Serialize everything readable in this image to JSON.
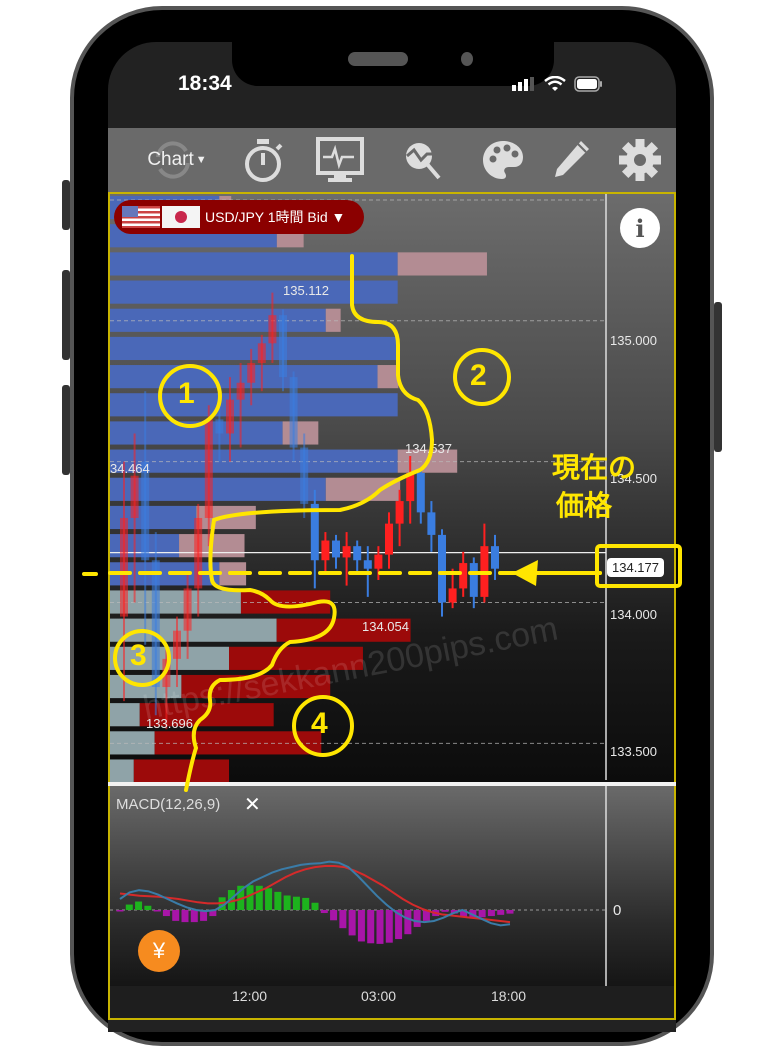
{
  "status_bar": {
    "time": "18:34"
  },
  "toolbar": {
    "chart_label": "Chart",
    "items": [
      {
        "name": "chart-menu",
        "icon": "refresh-icon"
      },
      {
        "name": "timer",
        "icon": "stopwatch-icon"
      },
      {
        "name": "monitor",
        "icon": "monitor-icon"
      },
      {
        "name": "indicator-search",
        "icon": "chart-search-icon"
      },
      {
        "name": "palette",
        "icon": "palette-icon"
      },
      {
        "name": "draw",
        "icon": "pencil-icon"
      },
      {
        "name": "settings",
        "icon": "gear-icon"
      }
    ]
  },
  "instrument": {
    "label": "USD/JPY 1時間 Bid ▼",
    "flags": [
      "US",
      "JP"
    ]
  },
  "price_axis": {
    "labels": [
      "135.000",
      "134.500",
      "134.000",
      "133.500"
    ],
    "current_price": "134.177"
  },
  "order_book_labels": {
    "high_marker": "135.112",
    "mid_marker_1": "134.537",
    "left_marker": "34.464",
    "low_marker_1": "134.054",
    "low_marker_2": "133.696"
  },
  "macd": {
    "title": "MACD(12,26,9)",
    "close_label": "✕",
    "zero_label": "0"
  },
  "time_axis": {
    "labels": [
      "12:00",
      "03:00",
      "18:00"
    ]
  },
  "annotations": {
    "circle_1": "1",
    "circle_2": "2",
    "circle_3": "3",
    "circle_4": "4",
    "current_price_note_line1": "現在の",
    "current_price_note_line2": "価格"
  },
  "watermark": "https://sekkann200pips.com",
  "colors": {
    "buy_bar": "#4a68b8",
    "sell_bar_light": "#b38c93",
    "buy_bar_lower": "#8fa3a8",
    "sell_bar_dark": "#9c0a0a",
    "annotation": "#ffe600",
    "macd_line": "#3a7ca8",
    "signal_line": "#d62a2a",
    "hist_pos": "#1db31d",
    "hist_neg": "#a815a8"
  },
  "chart_data": {
    "type": "candlestick-with-orderbook",
    "symbol": "USD/JPY",
    "timeframe": "1時間",
    "price_type": "Bid",
    "ylim": [
      133.37,
      135.45
    ],
    "yticks": [
      135.0,
      134.5,
      134.0,
      133.5
    ],
    "current_price": 134.177,
    "orderbook_rows": [
      {
        "price": 135.4,
        "buy": 0.38,
        "sell": 0.04
      },
      {
        "price": 135.3,
        "buy": 0.58,
        "sell": 0.09
      },
      {
        "price": 135.2,
        "buy": 1.0,
        "sell": 0.3
      },
      {
        "price": 135.1,
        "buy": 1.0,
        "sell": 0.0
      },
      {
        "price": 135.0,
        "buy": 0.75,
        "sell": 0.05
      },
      {
        "price": 134.9,
        "buy": 1.0,
        "sell": 0.0
      },
      {
        "price": 134.8,
        "buy": 0.93,
        "sell": 0.07
      },
      {
        "price": 134.7,
        "buy": 1.0,
        "sell": 0.0
      },
      {
        "price": 134.6,
        "buy": 0.6,
        "sell": 0.12
      },
      {
        "price": 134.5,
        "buy": 1.0,
        "sell": 0.2
      },
      {
        "price": 134.4,
        "buy": 0.75,
        "sell": 0.25
      },
      {
        "price": 134.3,
        "buy": 0.3,
        "sell": 0.2
      },
      {
        "price": 134.2,
        "buy": 0.24,
        "sell": 0.22
      },
      {
        "price": 134.1,
        "buy": 0.38,
        "sell": 0.09
      },
      {
        "price": 134.0,
        "lower_buy": 0.44,
        "lower_sell": 0.3
      },
      {
        "price": 133.9,
        "lower_buy": 0.56,
        "lower_sell": 0.45
      },
      {
        "price": 133.8,
        "lower_buy": 0.4,
        "lower_sell": 0.45
      },
      {
        "price": 133.7,
        "lower_buy": 0.24,
        "lower_sell": 0.5
      },
      {
        "price": 133.6,
        "lower_buy": 0.1,
        "lower_sell": 0.45
      },
      {
        "price": 133.5,
        "lower_buy": 0.15,
        "lower_sell": 0.56
      },
      {
        "price": 133.4,
        "lower_buy": 0.08,
        "lower_sell": 0.32
      }
    ],
    "candles": [
      {
        "o": 133.95,
        "h": 134.5,
        "l": 133.65,
        "c": 134.3
      },
      {
        "o": 134.3,
        "h": 134.6,
        "l": 134.0,
        "c": 134.45
      },
      {
        "o": 134.5,
        "h": 134.75,
        "l": 133.85,
        "c": 134.15
      },
      {
        "o": 134.15,
        "h": 134.25,
        "l": 133.6,
        "c": 133.7
      },
      {
        "o": 133.7,
        "h": 133.85,
        "l": 133.55,
        "c": 133.8
      },
      {
        "o": 133.8,
        "h": 133.95,
        "l": 133.7,
        "c": 133.9
      },
      {
        "o": 133.9,
        "h": 134.1,
        "l": 133.8,
        "c": 134.05
      },
      {
        "o": 134.05,
        "h": 134.35,
        "l": 133.95,
        "c": 134.3
      },
      {
        "o": 134.3,
        "h": 134.7,
        "l": 134.2,
        "c": 134.65
      },
      {
        "o": 134.65,
        "h": 134.7,
        "l": 134.5,
        "c": 134.6
      },
      {
        "o": 134.6,
        "h": 134.8,
        "l": 134.5,
        "c": 134.72
      },
      {
        "o": 134.72,
        "h": 134.85,
        "l": 134.55,
        "c": 134.78
      },
      {
        "o": 134.78,
        "h": 134.9,
        "l": 134.7,
        "c": 134.85
      },
      {
        "o": 134.85,
        "h": 134.95,
        "l": 134.75,
        "c": 134.92
      },
      {
        "o": 134.92,
        "h": 135.1,
        "l": 134.85,
        "c": 135.02
      },
      {
        "o": 135.02,
        "h": 135.04,
        "l": 134.75,
        "c": 134.8
      },
      {
        "o": 134.8,
        "h": 134.82,
        "l": 134.5,
        "c": 134.55
      },
      {
        "o": 134.55,
        "h": 134.6,
        "l": 134.3,
        "c": 134.35
      },
      {
        "o": 134.35,
        "h": 134.4,
        "l": 134.05,
        "c": 134.15
      },
      {
        "o": 134.15,
        "h": 134.25,
        "l": 134.1,
        "c": 134.22
      },
      {
        "o": 134.22,
        "h": 134.24,
        "l": 134.12,
        "c": 134.16
      },
      {
        "o": 134.16,
        "h": 134.25,
        "l": 134.06,
        "c": 134.2
      },
      {
        "o": 134.2,
        "h": 134.22,
        "l": 134.1,
        "c": 134.15
      },
      {
        "o": 134.15,
        "h": 134.2,
        "l": 134.02,
        "c": 134.12
      },
      {
        "o": 134.12,
        "h": 134.2,
        "l": 134.08,
        "c": 134.17
      },
      {
        "o": 134.17,
        "h": 134.32,
        "l": 134.12,
        "c": 134.28
      },
      {
        "o": 134.28,
        "h": 134.4,
        "l": 134.2,
        "c": 134.36
      },
      {
        "o": 134.36,
        "h": 134.52,
        "l": 134.28,
        "c": 134.46
      },
      {
        "o": 134.46,
        "h": 134.48,
        "l": 134.28,
        "c": 134.32
      },
      {
        "o": 134.32,
        "h": 134.36,
        "l": 134.18,
        "c": 134.24
      },
      {
        "o": 134.24,
        "h": 134.26,
        "l": 133.95,
        "c": 134.0
      },
      {
        "o": 134.0,
        "h": 134.12,
        "l": 133.98,
        "c": 134.05
      },
      {
        "o": 134.05,
        "h": 134.18,
        "l": 134.02,
        "c": 134.14
      },
      {
        "o": 134.14,
        "h": 134.16,
        "l": 133.98,
        "c": 134.02
      },
      {
        "o": 134.02,
        "h": 134.28,
        "l": 134.0,
        "c": 134.2
      },
      {
        "o": 134.2,
        "h": 134.24,
        "l": 134.08,
        "c": 134.12
      }
    ],
    "macd": {
      "params": [
        12,
        26,
        9
      ],
      "macd_line": [
        0.2,
        0.32,
        0.36,
        0.34,
        0.28,
        0.2,
        0.12,
        0.05,
        0.0,
        -0.02,
        0.0,
        0.1,
        0.25,
        0.4,
        0.52,
        0.6,
        0.68,
        0.74,
        0.78,
        0.82,
        0.84,
        0.85,
        0.88,
        0.86,
        0.78,
        0.62,
        0.44,
        0.26,
        0.1,
        -0.04,
        -0.14,
        -0.2,
        -0.22,
        -0.2,
        -0.14,
        -0.06,
        0.0,
        -0.08,
        -0.16,
        -0.24,
        -0.28,
        -0.26
      ],
      "signal_line": [
        0.3,
        0.28,
        0.26,
        0.25,
        0.24,
        0.22,
        0.2,
        0.17,
        0.14,
        0.12,
        0.12,
        0.14,
        0.18,
        0.24,
        0.32,
        0.4,
        0.5,
        0.6,
        0.68,
        0.74,
        0.78,
        0.8,
        0.8,
        0.78,
        0.72,
        0.64,
        0.54,
        0.44,
        0.32,
        0.2,
        0.1,
        0.02,
        -0.04,
        -0.08,
        -0.1,
        -0.12,
        -0.14,
        -0.16,
        -0.18,
        -0.2,
        -0.22
      ],
      "histogram": [
        -0.02,
        0.09,
        0.14,
        0.07,
        -0.02,
        -0.1,
        -0.18,
        -0.2,
        -0.2,
        -0.18,
        -0.1,
        0.21,
        0.33,
        0.4,
        0.41,
        0.4,
        0.36,
        0.3,
        0.24,
        0.22,
        0.2,
        0.12,
        -0.05,
        -0.17,
        -0.3,
        -0.42,
        -0.52,
        -0.55,
        -0.56,
        -0.54,
        -0.48,
        -0.4,
        -0.28,
        -0.18,
        -0.1,
        -0.03,
        -0.06,
        -0.12,
        -0.14,
        -0.12,
        -0.1,
        -0.08,
        -0.06
      ]
    },
    "xlabels": [
      "12:00",
      "03:00",
      "18:00"
    ]
  }
}
